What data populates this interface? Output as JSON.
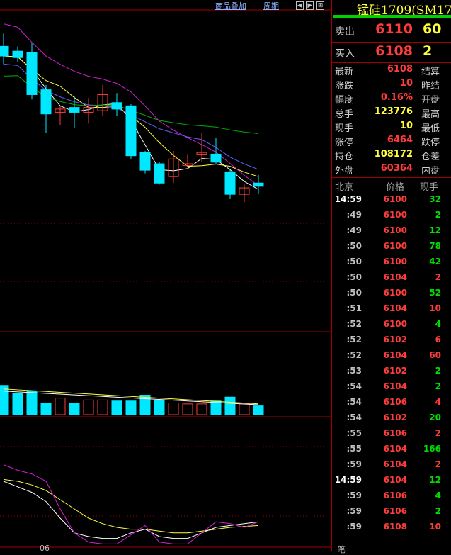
{
  "toolbar": {
    "overlay_label": "商品叠加",
    "period_label": "周期"
  },
  "instrument": {
    "title": "锰硅1709(SM17"
  },
  "quote": {
    "sell_label": "卖出",
    "sell_price": "6110",
    "sell_vol": "60",
    "buy_label": "买入",
    "buy_price": "6108",
    "buy_vol": "2"
  },
  "info": [
    {
      "l": "最新",
      "v": "6108",
      "c": "red",
      "r": "结算"
    },
    {
      "l": "涨跌",
      "v": "10",
      "c": "red",
      "r": "昨结"
    },
    {
      "l": "幅度",
      "v": "0.16%",
      "c": "red",
      "r": "开盘"
    },
    {
      "l": "总手",
      "v": "123776",
      "c": "yellow",
      "r": "最高"
    },
    {
      "l": "现手",
      "v": "10",
      "c": "yellow",
      "r": "最低"
    },
    {
      "l": "涨停",
      "v": "6464",
      "c": "red",
      "r": "跌停"
    },
    {
      "l": "持仓",
      "v": "108172",
      "c": "yellow",
      "r": "仓差"
    },
    {
      "l": "外盘",
      "v": "60364",
      "c": "red",
      "r": "内盘"
    }
  ],
  "ticks_header": {
    "time": "北京",
    "price": "价格",
    "vol": "现手"
  },
  "ticks": [
    {
      "t": "14:59",
      "full": true,
      "p": "6100",
      "v": "32",
      "c": "green"
    },
    {
      "t": ":49",
      "p": "6100",
      "v": "2",
      "c": "green"
    },
    {
      "t": ":49",
      "p": "6100",
      "v": "12",
      "c": "green"
    },
    {
      "t": ":50",
      "p": "6100",
      "v": "78",
      "c": "green"
    },
    {
      "t": ":50",
      "p": "6100",
      "v": "42",
      "c": "green"
    },
    {
      "t": ":50",
      "p": "6104",
      "v": "2",
      "c": "red"
    },
    {
      "t": ":50",
      "p": "6100",
      "v": "52",
      "c": "green"
    },
    {
      "t": ":51",
      "p": "6104",
      "v": "10",
      "c": "red"
    },
    {
      "t": ":52",
      "p": "6100",
      "v": "4",
      "c": "green"
    },
    {
      "t": ":52",
      "p": "6102",
      "v": "6",
      "c": "red"
    },
    {
      "t": ":52",
      "p": "6104",
      "v": "60",
      "c": "red"
    },
    {
      "t": ":53",
      "p": "6102",
      "v": "2",
      "c": "green"
    },
    {
      "t": ":54",
      "p": "6104",
      "v": "2",
      "c": "green"
    },
    {
      "t": ":54",
      "p": "6106",
      "v": "4",
      "c": "red"
    },
    {
      "t": ":54",
      "p": "6102",
      "v": "20",
      "c": "green"
    },
    {
      "t": ":55",
      "p": "6106",
      "v": "2",
      "c": "red"
    },
    {
      "t": ":55",
      "p": "6104",
      "v": "166",
      "c": "green"
    },
    {
      "t": ":59",
      "p": "6104",
      "v": "2",
      "c": "red"
    },
    {
      "t": "14:59",
      "full": true,
      "p": "6104",
      "v": "12",
      "c": "green"
    },
    {
      "t": ":59",
      "p": "6106",
      "v": "4",
      "c": "green"
    },
    {
      "t": ":59",
      "p": "6106",
      "v": "2",
      "c": "green"
    },
    {
      "t": ":59",
      "p": "6108",
      "v": "10",
      "c": "red"
    }
  ],
  "bottom": {
    "tab": "笔",
    "axis_label": "06"
  },
  "colors": {
    "up": "#ff3c3c",
    "down": "#00e8ff",
    "ma_white": "#ffffff",
    "ma_yellow": "#ffff3c",
    "ma_magenta": "#d020d0",
    "ma_blue": "#6060ff",
    "ma_green": "#00b000",
    "grid": "#a00000"
  },
  "chart_data": {
    "type": "candlestick",
    "candles": [
      {
        "o": 6180,
        "h": 6196,
        "l": 6158,
        "c": 6168
      },
      {
        "o": 6174,
        "h": 6180,
        "l": 6160,
        "c": 6166
      },
      {
        "o": 6172,
        "h": 6184,
        "l": 6114,
        "c": 6120
      },
      {
        "o": 6126,
        "h": 6132,
        "l": 6072,
        "c": 6096
      },
      {
        "o": 6098,
        "h": 6106,
        "l": 6082,
        "c": 6102
      },
      {
        "o": 6104,
        "h": 6118,
        "l": 6078,
        "c": 6098
      },
      {
        "o": 6098,
        "h": 6116,
        "l": 6084,
        "c": 6104
      },
      {
        "o": 6100,
        "h": 6132,
        "l": 6094,
        "c": 6120
      },
      {
        "o": 6110,
        "h": 6122,
        "l": 6094,
        "c": 6102
      },
      {
        "o": 6106,
        "h": 6108,
        "l": 6040,
        "c": 6044
      },
      {
        "o": 6048,
        "h": 6050,
        "l": 6022,
        "c": 6026
      },
      {
        "o": 6034,
        "h": 6036,
        "l": 6008,
        "c": 6010
      },
      {
        "o": 6018,
        "h": 6050,
        "l": 6010,
        "c": 6040
      },
      {
        "o": 6032,
        "h": 6046,
        "l": 6030,
        "c": 6034
      },
      {
        "o": 6046,
        "h": 6072,
        "l": 6036,
        "c": 6048
      },
      {
        "o": 6046,
        "h": 6066,
        "l": 6034,
        "c": 6036
      },
      {
        "o": 6024,
        "h": 6026,
        "l": 5990,
        "c": 5996
      },
      {
        "o": 5996,
        "h": 6008,
        "l": 5986,
        "c": 6004
      },
      {
        "o": 6010,
        "h": 6020,
        "l": 5996,
        "c": 6006
      }
    ],
    "volume": [
      30,
      22,
      24,
      12,
      17,
      12,
      15,
      15,
      14,
      14,
      20,
      15,
      12,
      11,
      11,
      14,
      18,
      11,
      9
    ],
    "volume_ma": [
      31,
      30,
      29,
      28,
      27,
      26,
      25,
      24,
      23,
      22,
      21,
      20,
      19,
      18,
      17,
      16,
      15,
      14,
      13
    ]
  }
}
